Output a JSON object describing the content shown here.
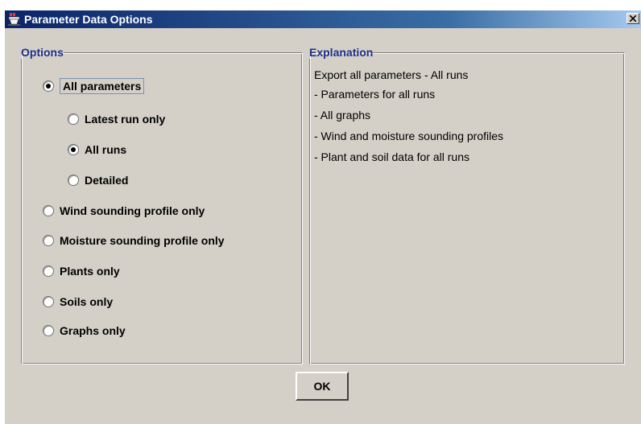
{
  "window": {
    "title": "Parameter Data Options"
  },
  "options": {
    "legend": "Options",
    "items": [
      {
        "label": "All parameters",
        "checked": true
      },
      {
        "label": "Latest run only",
        "checked": false
      },
      {
        "label": "All runs",
        "checked": true
      },
      {
        "label": "Detailed",
        "checked": false
      },
      {
        "label": "Wind sounding profile only",
        "checked": false
      },
      {
        "label": "Moisture sounding profile only",
        "checked": false
      },
      {
        "label": "Plants only",
        "checked": false
      },
      {
        "label": "Soils only",
        "checked": false
      },
      {
        "label": "Graphs only",
        "checked": false
      }
    ]
  },
  "explanation": {
    "legend": "Explanation",
    "lines": [
      "Export all parameters - All runs",
      "- Parameters for all runs",
      "- All graphs",
      "- Wind and moisture sounding profiles",
      "- Plant and soil data for all runs"
    ]
  },
  "buttons": {
    "ok_label": "OK"
  }
}
